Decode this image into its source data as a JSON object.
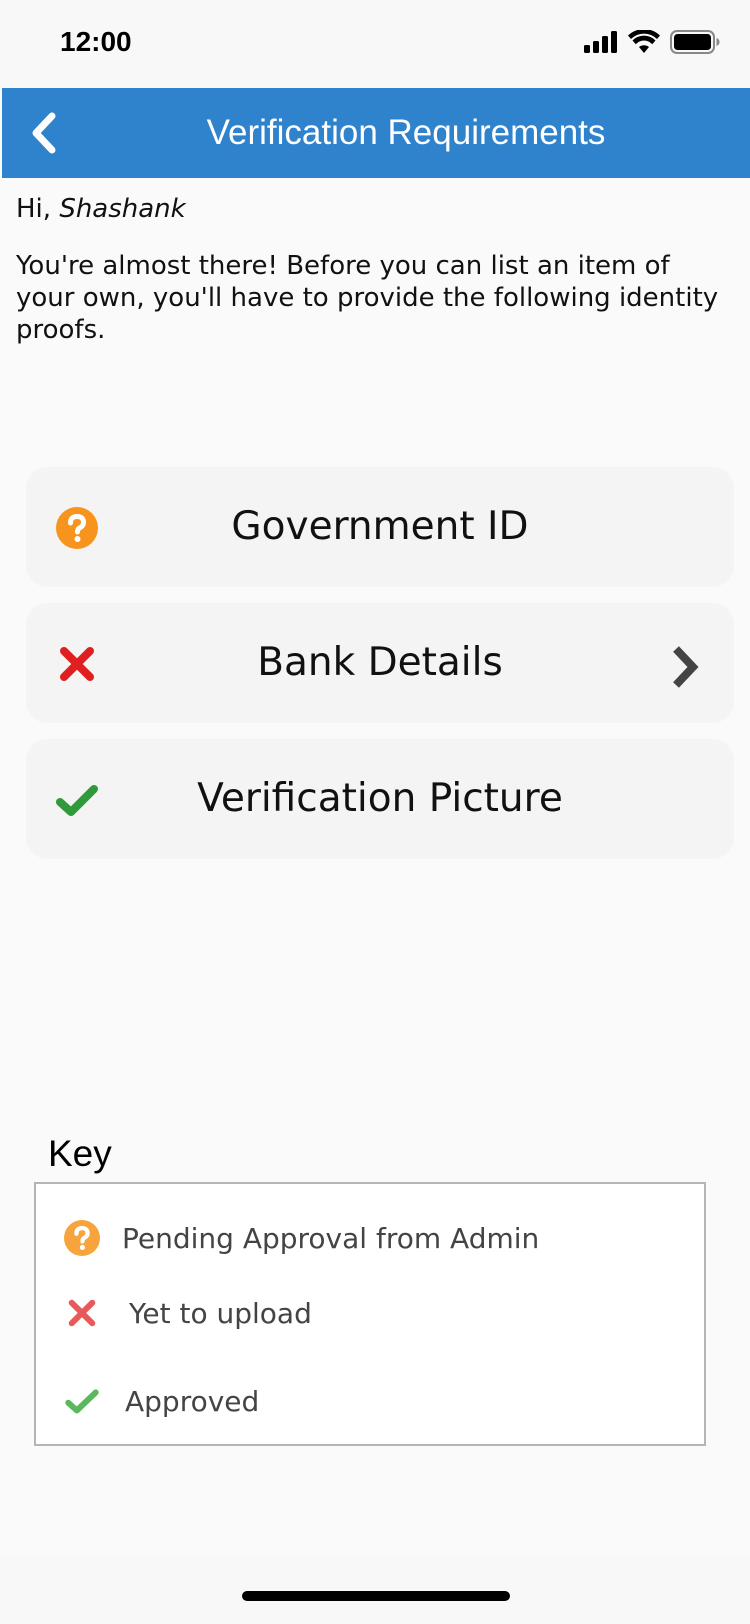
{
  "status_bar": {
    "time": "12:00"
  },
  "header": {
    "title": "Verification Requirements"
  },
  "greeting": {
    "prefix": "Hi, ",
    "name": "Shashank"
  },
  "intro_text": "You're almost there! Before you can list an item of your own, you'll have to provide the following identity proofs.",
  "requirements": [
    {
      "label": "Government ID",
      "status": "pending",
      "icon": "question-circle-icon"
    },
    {
      "label": "Bank Details",
      "status": "yet-to-upload",
      "icon": "cross-icon",
      "has_chevron": true
    },
    {
      "label": "Verification Picture",
      "status": "approved",
      "icon": "checkmark-icon"
    }
  ],
  "key": {
    "title": "Key",
    "items": [
      {
        "label": "Pending Approval from Admin",
        "icon": "question-circle-icon"
      },
      {
        "label": "Yet to upload",
        "icon": "cross-icon"
      },
      {
        "label": "Approved",
        "icon": "checkmark-icon"
      }
    ]
  },
  "colors": {
    "header_bg": "#2f83cc",
    "pending": "#f7941d",
    "rejected": "#e02020",
    "approved": "#2e9a3a"
  }
}
